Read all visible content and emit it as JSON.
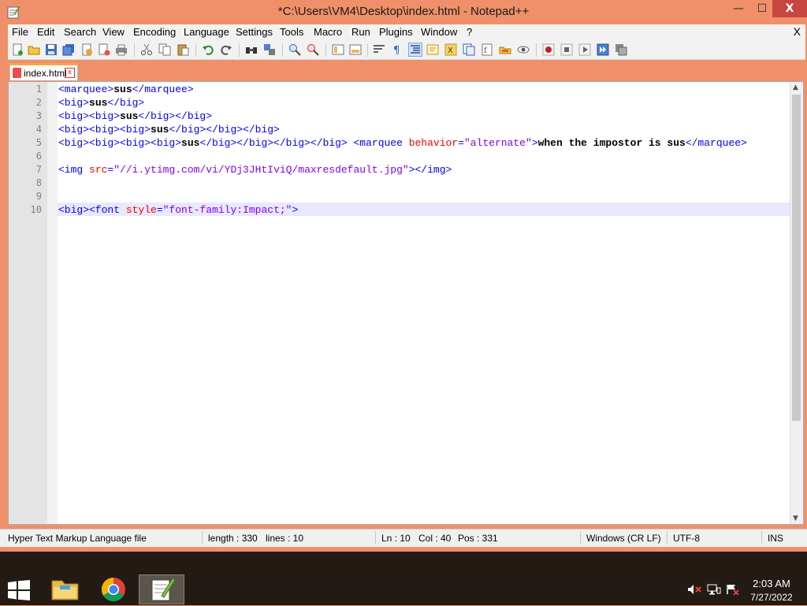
{
  "window": {
    "title": "*C:\\Users\\VM4\\Desktop\\index.html - Notepad++",
    "min_glyph": "—",
    "max_glyph": "☐",
    "close_glyph": "X"
  },
  "menu": {
    "items": [
      "File",
      "Edit",
      "Search",
      "View",
      "Encoding",
      "Language",
      "Settings",
      "Tools",
      "Macro",
      "Run",
      "Plugins",
      "Window",
      "?"
    ],
    "close_label": "X"
  },
  "tab": {
    "label": "index.html",
    "close_glyph": "x"
  },
  "editor": {
    "line_numbers": [
      "1",
      "2",
      "3",
      "4",
      "5",
      "6",
      "7",
      "8",
      "9",
      "10"
    ],
    "current_line": 10
  },
  "code": {
    "l1": {
      "open": "<marquee>",
      "text": "sus",
      "close": "</marquee>"
    },
    "l2": {
      "open": "<big>",
      "text": "sus",
      "close": "</big>"
    },
    "l3": {
      "open": "<big><big>",
      "text": "sus",
      "close": "</big></big>"
    },
    "l4": {
      "open": "<big><big><big>",
      "text": "sus",
      "close": "</big></big></big>"
    },
    "l5": {
      "open": "<big><big><big><big>",
      "text": "sus",
      "close": "</big></big></big></big>",
      "space": " ",
      "tag2": "<marquee ",
      "attr": "behavior",
      "eq": "=",
      "val": "\"alternate\"",
      "gt": ">",
      "text2": "when the impostor is sus",
      "close2": "</marquee>"
    },
    "l7": {
      "tag": "<img ",
      "attr": "src",
      "eq": "=",
      "val": "\"//i.ytimg.com/vi/YDj3JHtIviQ/maxresdefault.jpg\"",
      "close": "></img>"
    },
    "l10": {
      "tag": "<big><font ",
      "attr": "style",
      "eq": "=",
      "val": "\"font-family:Impact;\"",
      "gt": ">"
    }
  },
  "status": {
    "file_type": "Hyper Text Markup Language file",
    "length": "length : 330",
    "lines": "lines : 10",
    "ln": "Ln : 10",
    "col": "Col : 40",
    "pos": "Pos : 331",
    "eol": "Windows (CR LF)",
    "encoding": "UTF-8",
    "mode": "INS"
  },
  "clock": {
    "time": "2:03 AM",
    "date": "7/27/2022"
  },
  "colors": {
    "window_frame": "#f0906a",
    "tag_blue": "#0000ff",
    "attr_red": "#ff0000",
    "value_purple": "#8000ff",
    "current_line": "#e8e8ff",
    "taskbar": "#231b13",
    "close_red": "#c7463f"
  }
}
